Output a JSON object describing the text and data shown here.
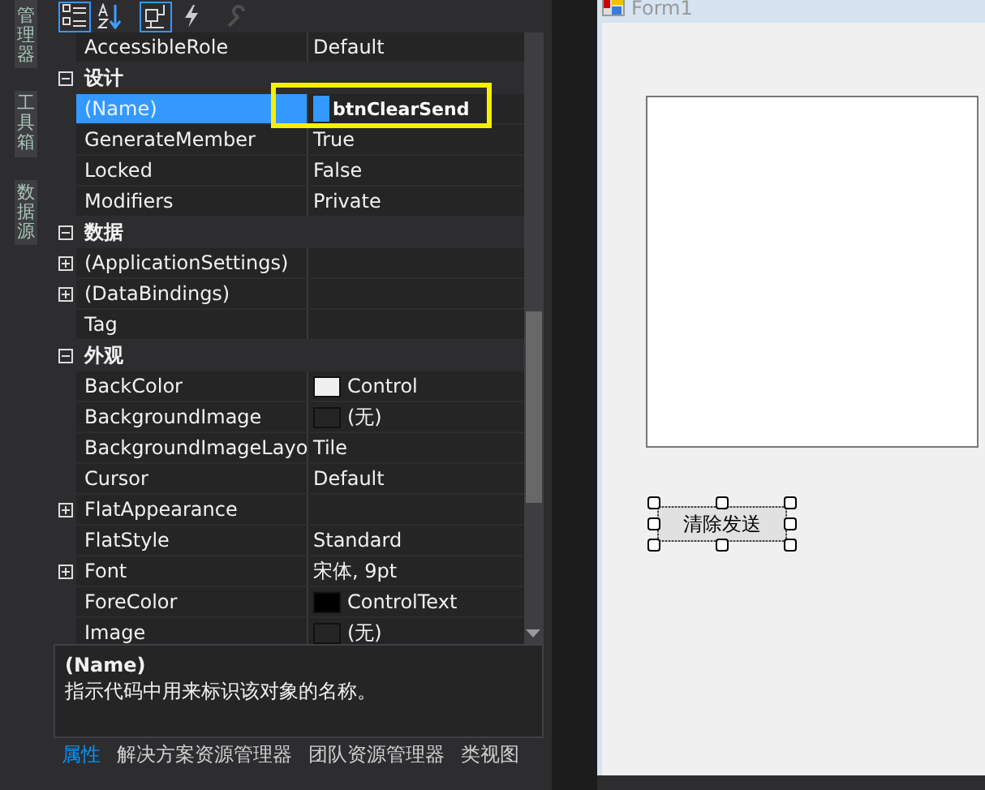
{
  "side_tabs": [
    {
      "label": "管理器"
    },
    {
      "label": "工具箱"
    },
    {
      "label": "数据源"
    }
  ],
  "toolbar": [
    {
      "kind": "categorized",
      "selected": true
    },
    {
      "kind": "alphabetical",
      "selected": false
    },
    {
      "kind": "properties",
      "selected": true
    },
    {
      "kind": "events",
      "selected": false
    },
    {
      "kind": "pages",
      "selected": false,
      "disabled": true
    }
  ],
  "properties": [
    {
      "kind": "property",
      "name": "AccessibleRole",
      "value": "Default",
      "selected": false
    },
    {
      "kind": "category",
      "name": "设计",
      "expanded": true
    },
    {
      "kind": "property",
      "name": "(Name)",
      "value": "btnClearSend",
      "selected": true,
      "highlighted": true
    },
    {
      "kind": "property",
      "name": "GenerateMember",
      "value": "True",
      "selected": false
    },
    {
      "kind": "property",
      "name": "Locked",
      "value": "False",
      "selected": false
    },
    {
      "kind": "property",
      "name": "Modifiers",
      "value": "Private",
      "selected": false
    },
    {
      "kind": "category",
      "name": "数据",
      "expanded": true
    },
    {
      "kind": "property",
      "name": "(ApplicationSettings)",
      "expandable": true,
      "selected": false
    },
    {
      "kind": "property",
      "name": "(DataBindings)",
      "expandable": true,
      "selected": false
    },
    {
      "kind": "property",
      "name": "Tag",
      "selected": false
    },
    {
      "kind": "category",
      "name": "外观",
      "expanded": true
    },
    {
      "kind": "property",
      "name": "BackColor",
      "value": "Control",
      "color": "#f0f0f0",
      "selected": false
    },
    {
      "kind": "property",
      "name": "BackgroundImage",
      "value": "(无)",
      "color": "#252526",
      "selected": false
    },
    {
      "kind": "property",
      "name": "BackgroundImageLayo",
      "value": "Tile",
      "selected": false
    },
    {
      "kind": "property",
      "name": "Cursor",
      "value": "Default",
      "selected": false
    },
    {
      "kind": "property",
      "name": "FlatAppearance",
      "expandable": true,
      "selected": false
    },
    {
      "kind": "property",
      "name": "FlatStyle",
      "value": "Standard",
      "selected": false
    },
    {
      "kind": "property",
      "name": "Font",
      "value": "宋体, 9pt",
      "expandable": true,
      "selected": false
    },
    {
      "kind": "property",
      "name": "ForeColor",
      "value": "ControlText",
      "color": "#000000",
      "selected": false
    },
    {
      "kind": "property",
      "name": "Image",
      "value": "(无)",
      "color": "#252526",
      "selected": false
    }
  ],
  "description": {
    "title": "(Name)",
    "text": "指示代码中用来标识该对象的名称。"
  },
  "bottom_tabs": [
    {
      "label": "属性",
      "selected": true
    },
    {
      "label": "解决方案资源管理器",
      "selected": false
    },
    {
      "label": "团队资源管理器",
      "selected": false
    },
    {
      "label": "类视图",
      "selected": false
    }
  ],
  "form": {
    "title": "Form1",
    "button": {
      "label": "清除发送",
      "selected": true
    }
  }
}
